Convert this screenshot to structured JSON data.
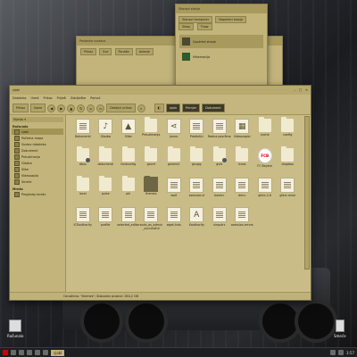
{
  "background_windows": {
    "small_dialog": {
      "title": "Stanovi stanje",
      "tabs": [
        "Stanovi komputer",
        "Napredni stanje",
        "Sleep",
        "Thaw"
      ],
      "options": [
        {
          "label": "Upotrebi stanje",
          "icon": "power-icon"
        },
        {
          "label": "Hibernacija",
          "icon": "moon-icon"
        }
      ]
    },
    "settings_window": {
      "title": "Postavke sustava",
      "tabs": [
        "Prikaz",
        "Sve",
        "Ponaša",
        "Izdanje"
      ]
    }
  },
  "file_manager": {
    "title": "sjabl",
    "menu": [
      "Datoteka",
      "Uredi",
      "Prikaz",
      "Prijeđi",
      "Zabilješke",
      "Pomoć"
    ],
    "toolbar": {
      "view_btn": "Prikaz",
      "view2_btn": "Ikone",
      "list_btn": "Detaljni prikaz",
      "crumbs": [
        "ojalo",
        "Primjer",
        "Dokument"
      ]
    },
    "sidebar": {
      "section1": "Računalo",
      "items": [
        "sjabl",
        "Početna mapa",
        "Sustav datoteka",
        "Dokumenti",
        "Preuzimanja",
        "Glazba",
        "Slike",
        "Videozapisi",
        "Smeće"
      ],
      "section2": "Mreža",
      "items2": [
        "Pregledaj mrežu"
      ]
    },
    "files": [
      {
        "name": "Dokumenti",
        "type": "doc"
      },
      {
        "name": "Glazba",
        "type": "music"
      },
      {
        "name": "Slike",
        "type": "image"
      },
      {
        "name": "Preuzimanja",
        "type": "folder"
      },
      {
        "name": "Javno",
        "type": "share"
      },
      {
        "name": "Predlošci",
        "type": "doc"
      },
      {
        "name": "Radna površina",
        "type": "doc"
      },
      {
        "name": "Videozapisi",
        "type": "film"
      },
      {
        "name": "cache",
        "type": "folder"
      },
      {
        "name": "config",
        "type": "folder"
      },
      {
        "name": "dbus",
        "type": "folder-badge"
      },
      {
        "name": "dokumenti",
        "type": "folder"
      },
      {
        "name": "fontconfig",
        "type": "folder"
      },
      {
        "name": "gconf",
        "type": "folder"
      },
      {
        "name": "gnome2",
        "type": "folder"
      },
      {
        "name": "gnupg",
        "type": "folder"
      },
      {
        "name": "gvfs",
        "type": "folder-badge"
      },
      {
        "name": "icons",
        "type": "folder"
      },
      {
        "name": "FC Bayern",
        "type": "fcb"
      },
      {
        "name": "dropbox",
        "type": "folder"
      },
      {
        "name": "local",
        "type": "folder"
      },
      {
        "name": "pulse",
        "type": "folder"
      },
      {
        "name": "pki",
        "type": "folder"
      },
      {
        "name": "themes",
        "type": "darkfolder",
        "selected": true
      },
      {
        "name": "wolf",
        "type": "doc"
      },
      {
        "name": "xsession.d",
        "type": "doc"
      },
      {
        "name": "bashrc",
        "type": "doc"
      },
      {
        "name": "dmrc",
        "type": "doc"
      },
      {
        "name": "gtkrc-2.0",
        "type": "doc"
      },
      {
        "name": "gtkrc.mine",
        "type": "doc"
      },
      {
        "name": "ICEauthority",
        "type": "doc"
      },
      {
        "name": "profile",
        "type": "doc"
      },
      {
        "name": "selected_editor",
        "type": "doc"
      },
      {
        "name": "sudo_as_admin_successful",
        "type": "doc"
      },
      {
        "name": "wget-hsts",
        "type": "doc"
      },
      {
        "name": "Xauthority",
        "type": "font"
      },
      {
        "name": "xinputrc",
        "type": "doc"
      },
      {
        "name": "xsession-errors",
        "type": "doc"
      }
    ],
    "status": "Označeno: \"themes\"; Slobodan prostor: 264,2 GB"
  },
  "desktop": {
    "icon1": "Računalo",
    "icon2": "Smeće"
  },
  "taskbar": {
    "task": "sjabl",
    "clock": "3:57"
  }
}
